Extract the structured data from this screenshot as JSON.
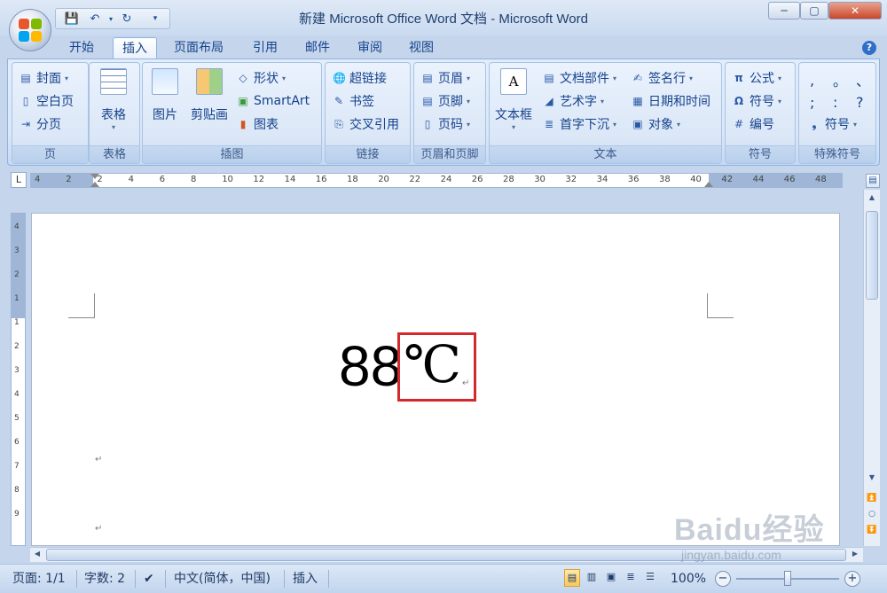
{
  "window": {
    "title": "新建 Microsoft Office Word 文档 - Microsoft Word"
  },
  "tabs": [
    "开始",
    "插入",
    "页面布局",
    "引用",
    "邮件",
    "审阅",
    "视图"
  ],
  "active_tab": "插入",
  "ribbon": {
    "page_group": {
      "label": "页",
      "items": [
        "封面",
        "空白页",
        "分页"
      ]
    },
    "table_group": {
      "label": "表格",
      "button": "表格"
    },
    "illustration_group": {
      "label": "插图",
      "picture": "图片",
      "clipart": "剪贴画",
      "shapes": "形状",
      "smartart": "SmartArt",
      "chart": "图表"
    },
    "links_group": {
      "label": "链接",
      "items": [
        "超链接",
        "书签",
        "交叉引用"
      ]
    },
    "header_footer_group": {
      "label": "页眉和页脚",
      "items": [
        "页眉",
        "页脚",
        "页码"
      ]
    },
    "text_group": {
      "label": "文本",
      "textbox": "文本框",
      "quickparts": "文档部件",
      "wordart": "艺术字",
      "dropcap": "首字下沉",
      "signature": "签名行",
      "datetime": "日期和时间",
      "object": "对象"
    },
    "symbols_group": {
      "label": "符号",
      "equation": "公式",
      "symbol": "符号",
      "number": "编号"
    },
    "special_group": {
      "label": "特殊符号",
      "row1": [
        ",",
        "。",
        "、"
      ],
      "row2": [
        ";",
        ":",
        "?"
      ],
      "symbol_button": "符号"
    }
  },
  "ruler_labels": [
    "4",
    "2",
    "2",
    "4",
    "6",
    "8",
    "10",
    "12",
    "14",
    "16",
    "18",
    "20",
    "22",
    "24",
    "26",
    "28",
    "30",
    "32",
    "34",
    "36",
    "38",
    "40",
    "42",
    "44",
    "46",
    "48"
  ],
  "vruler_labels": [
    "4",
    "3",
    "2",
    "1",
    "1",
    "2",
    "3",
    "4",
    "5",
    "6",
    "7",
    "8",
    "9"
  ],
  "document": {
    "number": "88",
    "symbol": "℃"
  },
  "status": {
    "page": "页面: 1/1",
    "words": "字数: 2",
    "language": "中文(简体，中国)",
    "mode": "插入",
    "zoom": "100%"
  },
  "watermark": {
    "brand": "Baidu经验",
    "url": "jingyan.baidu.com"
  },
  "colors": {
    "highlight_box": "#d3282c",
    "ribbon_text": "#15428b"
  }
}
